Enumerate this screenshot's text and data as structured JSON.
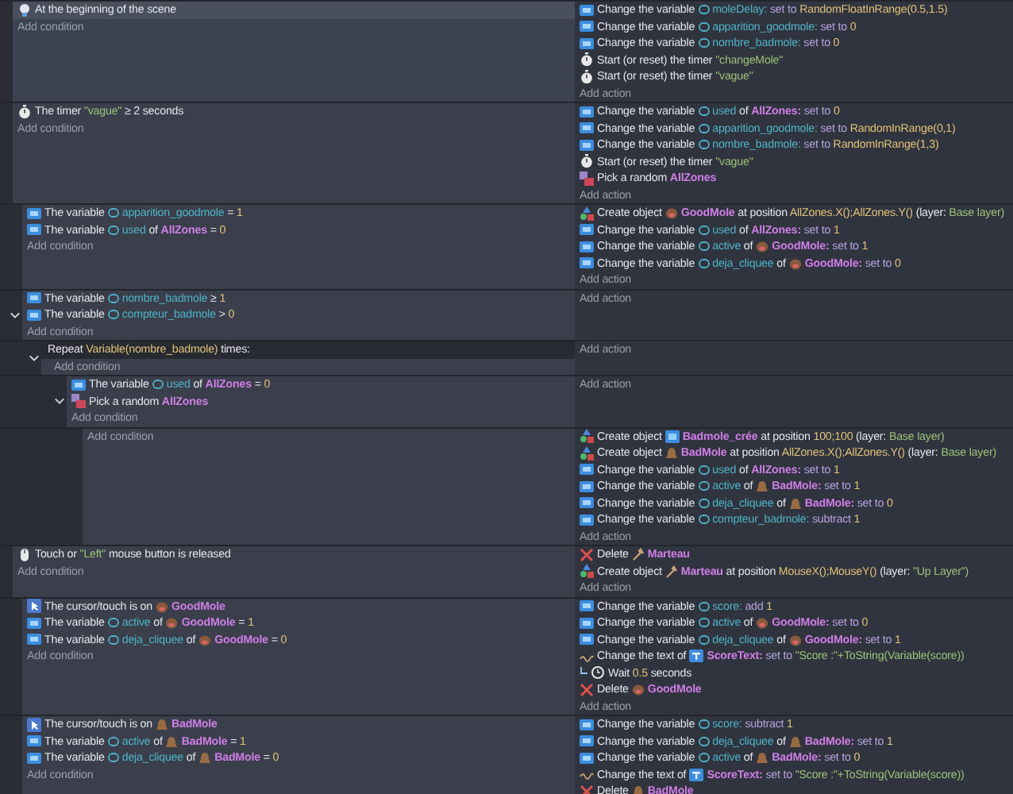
{
  "events": [
    {
      "selected": true,
      "add_condition": "Add condition",
      "add_action": "Add action",
      "conditions": [
        {
          "kind": "scene",
          "parts": [
            {
              "kind": "text",
              "text": "At the beginning of the scene"
            }
          ]
        }
      ],
      "actions": [
        {
          "kind": "variable",
          "parts": [
            {
              "kind": "text",
              "text": "Change the variable"
            },
            {
              "kind": "var",
              "text": "moleDelay:"
            },
            {
              "kind": "op",
              "text": "set to"
            },
            {
              "kind": "num",
              "text": "RandomFloatInRange(0.5,1.5)"
            }
          ]
        },
        {
          "kind": "variable",
          "parts": [
            {
              "kind": "text",
              "text": "Change the variable"
            },
            {
              "kind": "var",
              "text": "apparition_goodmole:"
            },
            {
              "kind": "op",
              "text": "set to"
            },
            {
              "kind": "num",
              "text": "0"
            }
          ]
        },
        {
          "kind": "variable",
          "parts": [
            {
              "kind": "text",
              "text": "Change the variable"
            },
            {
              "kind": "var",
              "text": "nombre_badmole:"
            },
            {
              "kind": "op",
              "text": "set to"
            },
            {
              "kind": "num",
              "text": "0"
            }
          ]
        },
        {
          "kind": "timer",
          "parts": [
            {
              "kind": "text",
              "text": "Start (or reset) the timer"
            },
            {
              "kind": "str",
              "text": "\"changeMole\""
            }
          ]
        },
        {
          "kind": "timer",
          "parts": [
            {
              "kind": "text",
              "text": "Start (or reset) the timer"
            },
            {
              "kind": "str",
              "text": "\"vague\""
            }
          ]
        }
      ]
    },
    {
      "selected": false,
      "add_condition": "Add condition",
      "add_action": "Add action",
      "conditions": [
        {
          "kind": "timer",
          "parts": [
            {
              "kind": "text",
              "text": "The timer"
            },
            {
              "kind": "str",
              "text": "\"vague\""
            },
            {
              "kind": "text",
              "text": "≥ 2 seconds"
            }
          ]
        }
      ],
      "actions": [
        {
          "kind": "variable",
          "parts": [
            {
              "kind": "text",
              "text": "Change the variable"
            },
            {
              "kind": "var",
              "text": "used"
            },
            {
              "kind": "text",
              "text": "of"
            },
            {
              "kind": "obj",
              "text": "AllZones:"
            },
            {
              "kind": "op",
              "text": "set to"
            },
            {
              "kind": "num",
              "text": "0"
            }
          ]
        },
        {
          "kind": "variable",
          "parts": [
            {
              "kind": "text",
              "text": "Change the variable"
            },
            {
              "kind": "var",
              "text": "apparition_goodmole:"
            },
            {
              "kind": "op",
              "text": "set to"
            },
            {
              "kind": "num",
              "text": "RandomInRange(0,1)"
            }
          ]
        },
        {
          "kind": "variable",
          "parts": [
            {
              "kind": "text",
              "text": "Change the variable"
            },
            {
              "kind": "var",
              "text": "nombre_badmole:"
            },
            {
              "kind": "op",
              "text": "set to"
            },
            {
              "kind": "num",
              "text": "RandomInRange(1,3)"
            }
          ]
        },
        {
          "kind": "timer",
          "parts": [
            {
              "kind": "text",
              "text": "Start (or reset) the timer"
            },
            {
              "kind": "str",
              "text": "\"vague\""
            }
          ]
        },
        {
          "kind": "pick",
          "parts": [
            {
              "kind": "text",
              "text": "Pick a random"
            },
            {
              "kind": "obj",
              "text": "AllZones"
            }
          ]
        }
      ],
      "children": [
        {
          "selected": false,
          "add_condition": "Add condition",
          "add_action": "Add action",
          "conditions": [
            {
              "kind": "variable",
              "parts": [
                {
                  "kind": "text",
                  "text": "The variable"
                },
                {
                  "kind": "var",
                  "text": "apparition_goodmole"
                },
                {
                  "kind": "text",
                  "text": "="
                },
                {
                  "kind": "num",
                  "text": "1"
                }
              ]
            },
            {
              "kind": "variable",
              "parts": [
                {
                  "kind": "text",
                  "text": "The variable"
                },
                {
                  "kind": "var",
                  "text": "used"
                },
                {
                  "kind": "text",
                  "text": "of"
                },
                {
                  "kind": "obj",
                  "text": "AllZones"
                },
                {
                  "kind": "text",
                  "text": "="
                },
                {
                  "kind": "num",
                  "text": "0"
                }
              ]
            }
          ],
          "actions": [
            {
              "kind": "create",
              "parts": [
                {
                  "kind": "text",
                  "text": "Create object"
                },
                {
                  "kind": "mole"
                },
                {
                  "kind": "obj",
                  "text": "GoodMole"
                },
                {
                  "kind": "text",
                  "text": "at position"
                },
                {
                  "kind": "num",
                  "text": "AllZones.X();AllZones.Y()"
                },
                {
                  "kind": "text",
                  "text": "(layer:"
                },
                {
                  "kind": "str",
                  "text": "Base layer)"
                }
              ]
            },
            {
              "kind": "variable",
              "parts": [
                {
                  "kind": "text",
                  "text": "Change the variable"
                },
                {
                  "kind": "var",
                  "text": "used"
                },
                {
                  "kind": "text",
                  "text": "of"
                },
                {
                  "kind": "obj",
                  "text": "AllZones:"
                },
                {
                  "kind": "op",
                  "text": "set to"
                },
                {
                  "kind": "num",
                  "text": "1"
                }
              ]
            },
            {
              "kind": "variable",
              "parts": [
                {
                  "kind": "text",
                  "text": "Change the variable"
                },
                {
                  "kind": "var",
                  "text": "active"
                },
                {
                  "kind": "text",
                  "text": "of"
                },
                {
                  "kind": "mole"
                },
                {
                  "kind": "obj",
                  "text": "GoodMole:"
                },
                {
                  "kind": "op",
                  "text": "set to"
                },
                {
                  "kind": "num",
                  "text": "1"
                }
              ]
            },
            {
              "kind": "variable",
              "parts": [
                {
                  "kind": "text",
                  "text": "Change the variable"
                },
                {
                  "kind": "var",
                  "text": "deja_cliquee"
                },
                {
                  "kind": "text",
                  "text": "of"
                },
                {
                  "kind": "mole"
                },
                {
                  "kind": "obj",
                  "text": "GoodMole:"
                },
                {
                  "kind": "op",
                  "text": "set to"
                },
                {
                  "kind": "num",
                  "text": "0"
                }
              ]
            }
          ]
        },
        {
          "selected": false,
          "expanded": true,
          "add_condition": "Add condition",
          "add_action": "Add action",
          "conditions": [
            {
              "kind": "variable",
              "parts": [
                {
                  "kind": "text",
                  "text": "The variable"
                },
                {
                  "kind": "var",
                  "text": "nombre_badmole"
                },
                {
                  "kind": "text",
                  "text": "≥"
                },
                {
                  "kind": "num",
                  "text": "1"
                }
              ]
            },
            {
              "kind": "variable",
              "parts": [
                {
                  "kind": "text",
                  "text": "The variable"
                },
                {
                  "kind": "var",
                  "text": "compteur_badmole"
                },
                {
                  "kind": "text",
                  "text": ">"
                },
                {
                  "kind": "num",
                  "text": "0"
                }
              ]
            }
          ],
          "children": [
            {
              "selected": false,
              "expanded": true,
              "kind": "repeat",
              "add_condition": "Add condition",
              "add_action": "Add action",
              "header": [
                {
                  "kind": "text",
                  "text": "Repeat"
                },
                {
                  "kind": "num",
                  "text": "Variable(nombre_badmole)"
                },
                {
                  "kind": "text",
                  "text": "times:"
                }
              ],
              "children": [
                {
                  "selected": false,
                  "expanded": true,
                  "add_condition": "Add condition",
                  "add_action": "Add action",
                  "conditions": [
                    {
                      "kind": "variable",
                      "parts": [
                        {
                          "kind": "text",
                          "text": "The variable"
                        },
                        {
                          "kind": "var",
                          "text": "used"
                        },
                        {
                          "kind": "text",
                          "text": "of"
                        },
                        {
                          "kind": "obj",
                          "text": "AllZones"
                        },
                        {
                          "kind": "text",
                          "text": "="
                        },
                        {
                          "kind": "num",
                          "text": "0"
                        }
                      ]
                    },
                    {
                      "kind": "pick",
                      "parts": [
                        {
                          "kind": "text",
                          "text": "Pick a random"
                        },
                        {
                          "kind": "obj",
                          "text": "AllZones"
                        }
                      ]
                    }
                  ],
                  "children": [
                    {
                      "selected": false,
                      "add_condition": "Add condition",
                      "add_action": "Add action",
                      "actions": [
                        {
                          "kind": "create",
                          "parts": [
                            {
                              "kind": "text",
                              "text": "Create object"
                            },
                            {
                              "kind": "sprite"
                            },
                            {
                              "kind": "obj",
                              "text": "Badmole_crée"
                            },
                            {
                              "kind": "text",
                              "text": "at position"
                            },
                            {
                              "kind": "num",
                              "text": "100;100"
                            },
                            {
                              "kind": "text",
                              "text": "(layer:"
                            },
                            {
                              "kind": "str",
                              "text": "Base layer)"
                            }
                          ]
                        },
                        {
                          "kind": "create",
                          "parts": [
                            {
                              "kind": "text",
                              "text": "Create object"
                            },
                            {
                              "kind": "badmole"
                            },
                            {
                              "kind": "obj",
                              "text": "BadMole"
                            },
                            {
                              "kind": "text",
                              "text": "at position"
                            },
                            {
                              "kind": "num",
                              "text": "AllZones.X();AllZones.Y()"
                            },
                            {
                              "kind": "text",
                              "text": "(layer:"
                            },
                            {
                              "kind": "str",
                              "text": "Base layer)"
                            }
                          ]
                        },
                        {
                          "kind": "variable",
                          "parts": [
                            {
                              "kind": "text",
                              "text": "Change the variable"
                            },
                            {
                              "kind": "var",
                              "text": "used"
                            },
                            {
                              "kind": "text",
                              "text": "of"
                            },
                            {
                              "kind": "obj",
                              "text": "AllZones:"
                            },
                            {
                              "kind": "op",
                              "text": "set to"
                            },
                            {
                              "kind": "num",
                              "text": "1"
                            }
                          ]
                        },
                        {
                          "kind": "variable",
                          "parts": [
                            {
                              "kind": "text",
                              "text": "Change the variable"
                            },
                            {
                              "kind": "var",
                              "text": "active"
                            },
                            {
                              "kind": "text",
                              "text": "of"
                            },
                            {
                              "kind": "badmole"
                            },
                            {
                              "kind": "obj",
                              "text": "BadMole:"
                            },
                            {
                              "kind": "op",
                              "text": "set to"
                            },
                            {
                              "kind": "num",
                              "text": "1"
                            }
                          ]
                        },
                        {
                          "kind": "variable",
                          "parts": [
                            {
                              "kind": "text",
                              "text": "Change the variable"
                            },
                            {
                              "kind": "var",
                              "text": "deja_cliquee"
                            },
                            {
                              "kind": "text",
                              "text": "of"
                            },
                            {
                              "kind": "badmole"
                            },
                            {
                              "kind": "obj",
                              "text": "BadMole:"
                            },
                            {
                              "kind": "op",
                              "text": "set to"
                            },
                            {
                              "kind": "num",
                              "text": "0"
                            }
                          ]
                        },
                        {
                          "kind": "variable",
                          "parts": [
                            {
                              "kind": "text",
                              "text": "Change the variable"
                            },
                            {
                              "kind": "var",
                              "text": "compteur_badmole:"
                            },
                            {
                              "kind": "op",
                              "text": "subtract"
                            },
                            {
                              "kind": "num",
                              "text": "1"
                            }
                          ]
                        }
                      ]
                    }
                  ]
                }
              ]
            }
          ]
        }
      ]
    },
    {
      "selected": false,
      "add_condition": "Add condition",
      "add_action": "Add action",
      "conditions": [
        {
          "kind": "mouse",
          "parts": [
            {
              "kind": "text",
              "text": "Touch or"
            },
            {
              "kind": "str",
              "text": "\"Left\""
            },
            {
              "kind": "text",
              "text": "mouse button is released"
            }
          ]
        }
      ],
      "actions": [
        {
          "kind": "delete",
          "parts": [
            {
              "kind": "text",
              "text": "Delete"
            },
            {
              "kind": "hammer"
            },
            {
              "kind": "obj",
              "text": "Marteau"
            }
          ]
        },
        {
          "kind": "create",
          "parts": [
            {
              "kind": "text",
              "text": "Create object"
            },
            {
              "kind": "hammer"
            },
            {
              "kind": "obj",
              "text": "Marteau"
            },
            {
              "kind": "text",
              "text": "at position"
            },
            {
              "kind": "num",
              "text": "MouseX();MouseY()"
            },
            {
              "kind": "text",
              "text": "(layer:"
            },
            {
              "kind": "str",
              "text": "\"Up Layer\")"
            }
          ]
        }
      ],
      "children": [
        {
          "selected": false,
          "add_condition": "Add condition",
          "add_action": "Add action",
          "conditions": [
            {
              "kind": "cursor",
              "parts": [
                {
                  "kind": "text",
                  "text": "The cursor/touch is on"
                },
                {
                  "kind": "mole"
                },
                {
                  "kind": "obj",
                  "text": "GoodMole"
                }
              ]
            },
            {
              "kind": "variable",
              "parts": [
                {
                  "kind": "text",
                  "text": "The variable"
                },
                {
                  "kind": "var",
                  "text": "active"
                },
                {
                  "kind": "text",
                  "text": "of"
                },
                {
                  "kind": "mole"
                },
                {
                  "kind": "obj",
                  "text": "GoodMole"
                },
                {
                  "kind": "text",
                  "text": "="
                },
                {
                  "kind": "num",
                  "text": "1"
                }
              ]
            },
            {
              "kind": "variable",
              "parts": [
                {
                  "kind": "text",
                  "text": "The variable"
                },
                {
                  "kind": "var",
                  "text": "deja_cliquee"
                },
                {
                  "kind": "text",
                  "text": "of"
                },
                {
                  "kind": "mole"
                },
                {
                  "kind": "obj",
                  "text": "GoodMole"
                },
                {
                  "kind": "text",
                  "text": "="
                },
                {
                  "kind": "num",
                  "text": "0"
                }
              ]
            }
          ],
          "actions": [
            {
              "kind": "variable",
              "parts": [
                {
                  "kind": "text",
                  "text": "Change the variable"
                },
                {
                  "kind": "var",
                  "text": "score:"
                },
                {
                  "kind": "op",
                  "text": "add"
                },
                {
                  "kind": "num",
                  "text": "1"
                }
              ]
            },
            {
              "kind": "variable",
              "parts": [
                {
                  "kind": "text",
                  "text": "Change the variable"
                },
                {
                  "kind": "var",
                  "text": "active"
                },
                {
                  "kind": "text",
                  "text": "of"
                },
                {
                  "kind": "mole"
                },
                {
                  "kind": "obj",
                  "text": "GoodMole:"
                },
                {
                  "kind": "op",
                  "text": "set to"
                },
                {
                  "kind": "num",
                  "text": "0"
                }
              ]
            },
            {
              "kind": "variable",
              "parts": [
                {
                  "kind": "text",
                  "text": "Change the variable"
                },
                {
                  "kind": "var",
                  "text": "deja_cliquee"
                },
                {
                  "kind": "text",
                  "text": "of"
                },
                {
                  "kind": "mole"
                },
                {
                  "kind": "obj",
                  "text": "GoodMole:"
                },
                {
                  "kind": "op",
                  "text": "set to"
                },
                {
                  "kind": "num",
                  "text": "1"
                }
              ]
            },
            {
              "kind": "textchange",
              "parts": [
                {
                  "kind": "text",
                  "text": "Change the text of"
                },
                {
                  "kind": "textobj"
                },
                {
                  "kind": "obj",
                  "text": "ScoreText:"
                },
                {
                  "kind": "op",
                  "text": "set to"
                },
                {
                  "kind": "str",
                  "text": "\"Score :\"+ToString(Variable(score))"
                }
              ]
            },
            {
              "kind": "wait",
              "parts": [
                {
                  "kind": "text",
                  "text": "Wait"
                },
                {
                  "kind": "num",
                  "text": "0.5"
                },
                {
                  "kind": "text",
                  "text": "seconds"
                }
              ]
            },
            {
              "kind": "delete",
              "parts": [
                {
                  "kind": "text",
                  "text": "Delete"
                },
                {
                  "kind": "mole"
                },
                {
                  "kind": "obj",
                  "text": "GoodMole"
                }
              ]
            }
          ]
        },
        {
          "selected": false,
          "add_condition": "Add condition",
          "conditions": [
            {
              "kind": "cursor",
              "parts": [
                {
                  "kind": "text",
                  "text": "The cursor/touch is on"
                },
                {
                  "kind": "badmole"
                },
                {
                  "kind": "obj",
                  "text": "BadMole"
                }
              ]
            },
            {
              "kind": "variable",
              "parts": [
                {
                  "kind": "text",
                  "text": "The variable"
                },
                {
                  "kind": "var",
                  "text": "active"
                },
                {
                  "kind": "text",
                  "text": "of"
                },
                {
                  "kind": "badmole"
                },
                {
                  "kind": "obj",
                  "text": "BadMole"
                },
                {
                  "kind": "text",
                  "text": "="
                },
                {
                  "kind": "num",
                  "text": "1"
                }
              ]
            },
            {
              "kind": "variable",
              "parts": [
                {
                  "kind": "text",
                  "text": "The variable"
                },
                {
                  "kind": "var",
                  "text": "deja_cliquee"
                },
                {
                  "kind": "text",
                  "text": "of"
                },
                {
                  "kind": "badmole"
                },
                {
                  "kind": "obj",
                  "text": "BadMole"
                },
                {
                  "kind": "text",
                  "text": "="
                },
                {
                  "kind": "num",
                  "text": "0"
                }
              ]
            }
          ],
          "actions": [
            {
              "kind": "variable",
              "parts": [
                {
                  "kind": "text",
                  "text": "Change the variable"
                },
                {
                  "kind": "var",
                  "text": "score:"
                },
                {
                  "kind": "op",
                  "text": "subtract"
                },
                {
                  "kind": "num",
                  "text": "1"
                }
              ]
            },
            {
              "kind": "variable",
              "parts": [
                {
                  "kind": "text",
                  "text": "Change the variable"
                },
                {
                  "kind": "var",
                  "text": "deja_cliquee"
                },
                {
                  "kind": "text",
                  "text": "of"
                },
                {
                  "kind": "badmole"
                },
                {
                  "kind": "obj",
                  "text": "BadMole:"
                },
                {
                  "kind": "op",
                  "text": "set to"
                },
                {
                  "kind": "num",
                  "text": "1"
                }
              ]
            },
            {
              "kind": "variable",
              "parts": [
                {
                  "kind": "text",
                  "text": "Change the variable"
                },
                {
                  "kind": "var",
                  "text": "active"
                },
                {
                  "kind": "text",
                  "text": "of"
                },
                {
                  "kind": "badmole"
                },
                {
                  "kind": "obj",
                  "text": "BadMole:"
                },
                {
                  "kind": "op",
                  "text": "set to"
                },
                {
                  "kind": "num",
                  "text": "0"
                }
              ]
            },
            {
              "kind": "textchange",
              "parts": [
                {
                  "kind": "text",
                  "text": "Change the text of"
                },
                {
                  "kind": "textobj"
                },
                {
                  "kind": "obj",
                  "text": "ScoreText:"
                },
                {
                  "kind": "op",
                  "text": "set to"
                },
                {
                  "kind": "str",
                  "text": "\"Score :\"+ToString(Variable(score))"
                }
              ]
            },
            {
              "kind": "delete",
              "parts": [
                {
                  "kind": "text",
                  "text": "Delete"
                },
                {
                  "kind": "badmole"
                },
                {
                  "kind": "obj",
                  "text": "BadMole"
                }
              ]
            }
          ]
        }
      ]
    }
  ]
}
